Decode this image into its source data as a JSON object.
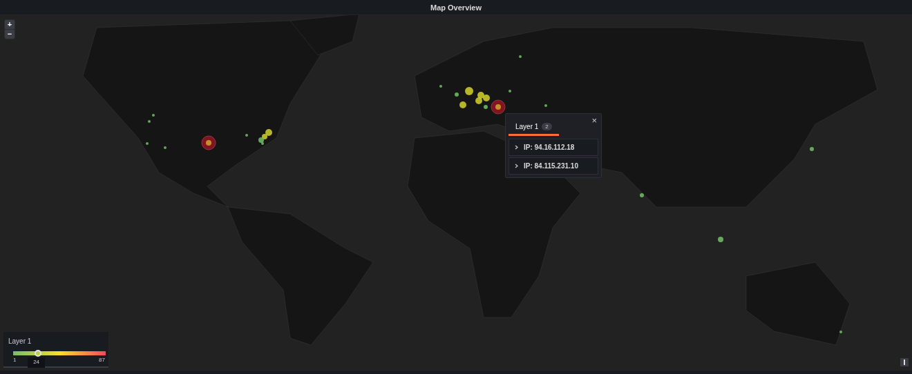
{
  "panel": {
    "title": "Map Overview"
  },
  "zoom_controls": [
    {
      "label": "+"
    },
    {
      "label": "−"
    }
  ],
  "popup": {
    "close": "×",
    "tabs": [
      {
        "label": "Layer 1",
        "count": "2",
        "selected": true
      }
    ],
    "items": [
      {
        "label": "IP: 94.16.112.18",
        "expanded": false
      },
      {
        "label": "IP: 84.115.231.10",
        "expanded": false
      }
    ]
  },
  "legend": {
    "title": "Layer 1",
    "min": "1",
    "max": "87",
    "level": 0.27,
    "reading": "24"
  }
}
